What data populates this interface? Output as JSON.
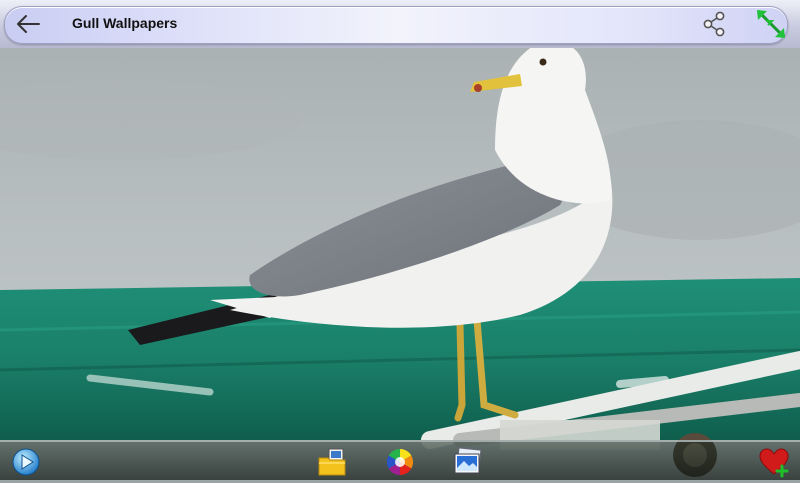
{
  "header": {
    "title": "Gull Wallpapers",
    "icons": {
      "back": "arrow-left-icon",
      "share": "share-icon",
      "fullscreen": "expand-arrows-icon"
    }
  },
  "toolbar": {
    "icons": [
      "play-slideshow-icon",
      "folder-images-icon",
      "color-wheel-icon",
      "photo-gallery-icon",
      "favorite-heart-add-icon"
    ]
  },
  "colors": {
    "header_pill": "#dfe1fa",
    "bottom_bar": "#1b2a22",
    "fullscreen_green": "#22c13a",
    "heart_red": "#d11a1a"
  }
}
